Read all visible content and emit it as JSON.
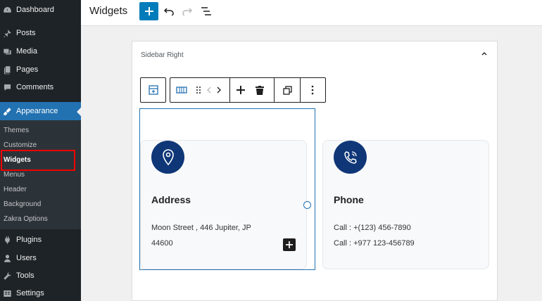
{
  "sidebar": {
    "items": [
      {
        "label": "Dashboard",
        "icon": "dashboard-icon"
      },
      {
        "label": "Posts",
        "icon": "pin-icon"
      },
      {
        "label": "Media",
        "icon": "media-icon"
      },
      {
        "label": "Pages",
        "icon": "pages-icon"
      },
      {
        "label": "Comments",
        "icon": "comment-icon"
      },
      {
        "label": "Appearance",
        "icon": "brush-icon"
      },
      {
        "label": "Plugins",
        "icon": "plugin-icon"
      },
      {
        "label": "Users",
        "icon": "user-icon"
      },
      {
        "label": "Tools",
        "icon": "wrench-icon"
      },
      {
        "label": "Settings",
        "icon": "settings-icon"
      }
    ],
    "submenu": [
      "Themes",
      "Customize",
      "Widgets",
      "Menus",
      "Header",
      "Background",
      "Zakra Options"
    ],
    "current_submenu": "Widgets"
  },
  "header": {
    "title": "Widgets"
  },
  "panel": {
    "title": "Sidebar Right"
  },
  "cards": [
    {
      "title": "Address",
      "lines": [
        "Moon Street , 446 Jupiter, JP",
        "44600"
      ],
      "icon": "location-pin-icon"
    },
    {
      "title": "Phone",
      "lines": [
        "Call : +(123) 456-7890",
        "Call : +977 123-456789"
      ],
      "icon": "phone-icon"
    }
  ],
  "colors": {
    "sidebar_bg": "#1d2327",
    "accent": "#2271b1",
    "icon_circle": "#0f3677",
    "highlight": "#ee0000"
  }
}
